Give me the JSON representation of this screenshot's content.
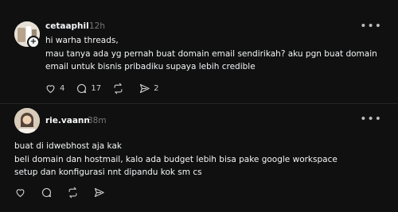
{
  "posts": [
    {
      "username": "cetaaphil",
      "time": "12h",
      "text": "hi warha threads,\nmau tanya ada yg pernah buat domain email sendirikah? aku pgn buat domain\nemail untuk bisnis pribadiku supaya lebih credible",
      "avatar_icon": "profile-photo",
      "follow_icon": "plus-icon",
      "more_icon": "ellipsis-icon",
      "actions": {
        "like": "4",
        "reply": "17",
        "repost": "",
        "share": "2"
      }
    },
    {
      "username": "rie.vaann",
      "time": "38m",
      "text": "buat di idwebhost aja kak\nbeli domain dan hostmail, kalo ada budget lebih bisa pake google workspace\nsetup dan konfigurasi nnt dipandu kok sm cs",
      "avatar_icon": "profile-photo",
      "more_icon": "ellipsis-icon",
      "actions": {
        "like": "",
        "reply": "",
        "repost": "",
        "share": ""
      }
    }
  ],
  "colors": {
    "background": "#101010",
    "text": "#f3f5f7",
    "muted": "#777777",
    "divider": "#262626"
  }
}
